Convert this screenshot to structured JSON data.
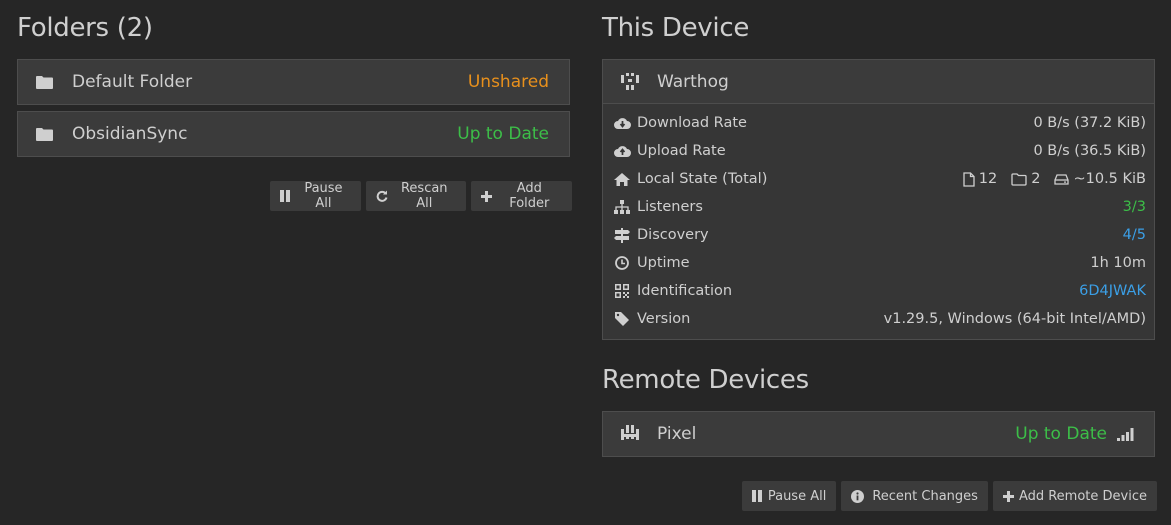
{
  "folders": {
    "heading": "Folders (2)",
    "items": [
      {
        "name": "Default Folder",
        "status": "Unshared"
      },
      {
        "name": "ObsidianSync",
        "status": "Up to Date"
      }
    ],
    "buttons": {
      "pause_all": "Pause All",
      "rescan_all": "Rescan All",
      "add_folder": "Add Folder"
    }
  },
  "this_device": {
    "heading": "This Device",
    "name": "Warthog",
    "rows": {
      "download": {
        "label": "Download Rate",
        "value": "0 B/s (37.2 KiB)"
      },
      "upload": {
        "label": "Upload Rate",
        "value": "0 B/s (36.5 KiB)"
      },
      "local_state": {
        "label": "Local State (Total)",
        "files": "12",
        "folders": "2",
        "size": "~10.5 KiB"
      },
      "listeners": {
        "label": "Listeners",
        "value": "3/3"
      },
      "discovery": {
        "label": "Discovery",
        "value": "4/5"
      },
      "uptime": {
        "label": "Uptime",
        "value": "1h 10m"
      },
      "identification": {
        "label": "Identification",
        "value": "6D4JWAK"
      },
      "version": {
        "label": "Version",
        "value": "v1.29.5, Windows (64-bit Intel/AMD)"
      }
    }
  },
  "remote_devices": {
    "heading": "Remote Devices",
    "items": [
      {
        "name": "Pixel",
        "status": "Up to Date"
      }
    ],
    "buttons": {
      "pause_all": "Pause All",
      "recent_changes": "Recent Changes",
      "add_remote": "Add Remote Device"
    }
  },
  "colors": {
    "background": "#262626",
    "panel": "#3b3b3b",
    "orange": "#e8901c",
    "green": "#3cbe48",
    "blue": "#3b9fe6"
  },
  "icons": [
    "folder-icon",
    "pause-icon",
    "refresh-icon",
    "plus-icon",
    "device-identicon",
    "cloud-download-icon",
    "cloud-upload-icon",
    "home-icon",
    "file-icon",
    "folder-outline-icon",
    "hdd-icon",
    "sitemap-icon",
    "signpost-icon",
    "clock-icon",
    "qrcode-icon",
    "tag-icon",
    "info-icon",
    "signal-icon"
  ]
}
